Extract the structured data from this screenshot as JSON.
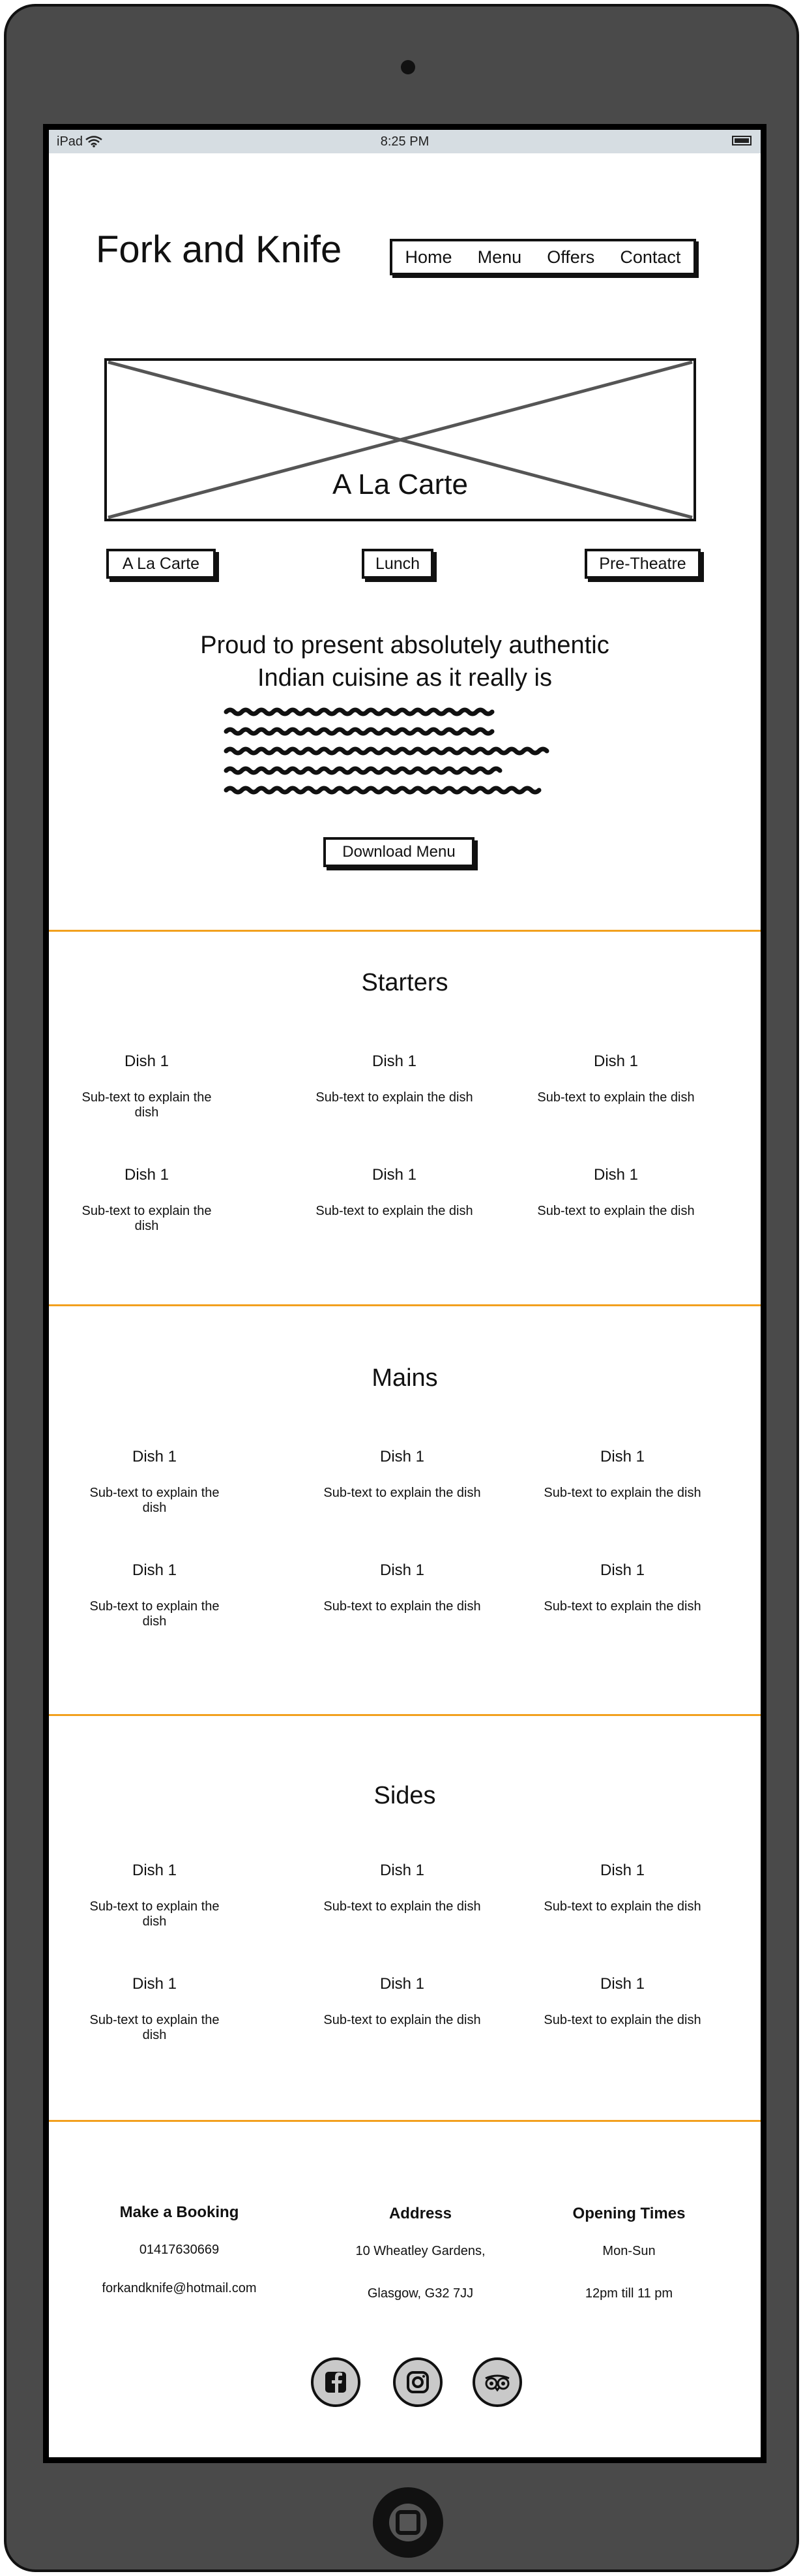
{
  "status_bar": {
    "carrier": "iPad",
    "time": "8:25 PM"
  },
  "header": {
    "brand": "Fork and Knife",
    "nav": [
      "Home",
      "Menu",
      "Offers",
      "Contact"
    ]
  },
  "hero": {
    "title": "A La Carte"
  },
  "menu_tabs": [
    "A La Carte",
    "Lunch",
    "Pre-Theatre"
  ],
  "intro": {
    "heading_line1": "Proud to present absolutely authentic",
    "heading_line2": "Indian cuisine as it really is",
    "download_label": "Download Menu"
  },
  "sections": [
    {
      "title": "Starters",
      "dishes": [
        {
          "name": "Dish 1",
          "sub": "Sub-text to explain the dish"
        },
        {
          "name": "Dish 1",
          "sub": "Sub-text to explain the dish"
        },
        {
          "name": "Dish 1",
          "sub": "Sub-text to explain the dish"
        },
        {
          "name": "Dish 1",
          "sub": "Sub-text to explain the dish"
        },
        {
          "name": "Dish 1",
          "sub": "Sub-text to explain the dish"
        },
        {
          "name": "Dish 1",
          "sub": "Sub-text to explain the dish"
        }
      ]
    },
    {
      "title": "Mains",
      "dishes": [
        {
          "name": "Dish 1",
          "sub": "Sub-text to explain the dish"
        },
        {
          "name": "Dish 1",
          "sub": "Sub-text to explain the dish"
        },
        {
          "name": "Dish 1",
          "sub": "Sub-text to explain the dish"
        },
        {
          "name": "Dish 1",
          "sub": "Sub-text to explain the dish"
        },
        {
          "name": "Dish 1",
          "sub": "Sub-text to explain the dish"
        },
        {
          "name": "Dish 1",
          "sub": "Sub-text to explain the dish"
        }
      ]
    },
    {
      "title": "Sides",
      "dishes": [
        {
          "name": "Dish 1",
          "sub": "Sub-text to explain the dish"
        },
        {
          "name": "Dish 1",
          "sub": "Sub-text to explain the dish"
        },
        {
          "name": "Dish 1",
          "sub": "Sub-text to explain the dish"
        },
        {
          "name": "Dish 1",
          "sub": "Sub-text to explain the dish"
        },
        {
          "name": "Dish 1",
          "sub": "Sub-text to explain the dish"
        },
        {
          "name": "Dish 1",
          "sub": "Sub-text to explain the dish"
        }
      ]
    }
  ],
  "footer": {
    "booking": {
      "heading": "Make a Booking",
      "phone": "01417630669",
      "email": "forkandknife@hotmail.com"
    },
    "address": {
      "heading": "Address",
      "line1": "10 Wheatley Gardens,",
      "line2": "Glasgow, G32 7JJ"
    },
    "hours": {
      "heading": "Opening Times",
      "days": "Mon-Sun",
      "times": "12pm till 11 pm"
    },
    "social_icons": [
      "facebook-icon",
      "instagram-icon",
      "tripadvisor-icon"
    ]
  },
  "colors": {
    "divider": "#f2a01e",
    "device_frame": "#4a4a4a",
    "status_bar": "#d6dde2"
  }
}
